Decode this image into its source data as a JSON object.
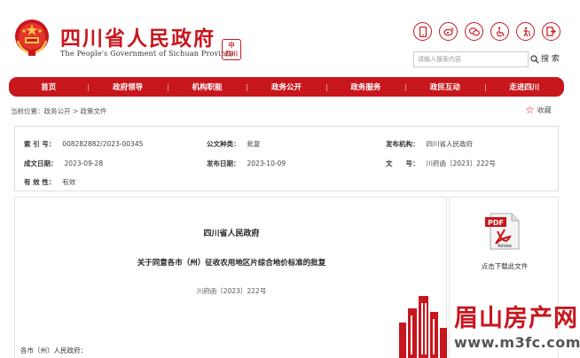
{
  "header": {
    "title": "四川省人民政府",
    "subtitle": "The People's Government of Sichuan Province",
    "seal_text": "中华人民四川",
    "icons": [
      "mobile-icon",
      "weibo-icon",
      "wechat-icon",
      "accessibility-icon",
      "elder-care-icon",
      "exit-icon"
    ],
    "search_placeholder": "请输入搜索内容",
    "search_label": "搜 索"
  },
  "nav": {
    "items": [
      "首页",
      "政府领导",
      "机构职能",
      "政务公开",
      "政务服务",
      "政民互动",
      "走进四川"
    ]
  },
  "breadcrumb": {
    "text": "当前位置：政务公开 > 政策文件"
  },
  "favorite": {
    "label": "收藏"
  },
  "info": {
    "index_label": "索 引 号：",
    "index_value": "008282882/2023-00345",
    "category_label": "公文种类：",
    "category_value": "批复",
    "publisher_label": "发布机构：",
    "publisher_value": "四川省人民政府",
    "created_label": "成文日期：",
    "created_value": "2023-09-28",
    "published_label": "发布日期：",
    "published_value": "2023-10-09",
    "docno_label": "文　　号：",
    "docno_value": "川府函〔2023〕222号",
    "validity_label": "有 效 性：",
    "validity_value": "有效"
  },
  "document": {
    "org": "四川省人民政府",
    "title": "关于同意各市（州）征收农用地区片综合地价标准的批复",
    "number": "川府函〔2023〕222号",
    "salutation": "各市（州）人民政府："
  },
  "sidebar": {
    "pdf_label": "PDF",
    "adobe_label": "Adobe",
    "download_text": "点击下载此文件"
  },
  "watermark": {
    "title": "眉山房产网",
    "url": "www.m3fc.com"
  },
  "colors": {
    "brand_red": "#c8161d"
  }
}
